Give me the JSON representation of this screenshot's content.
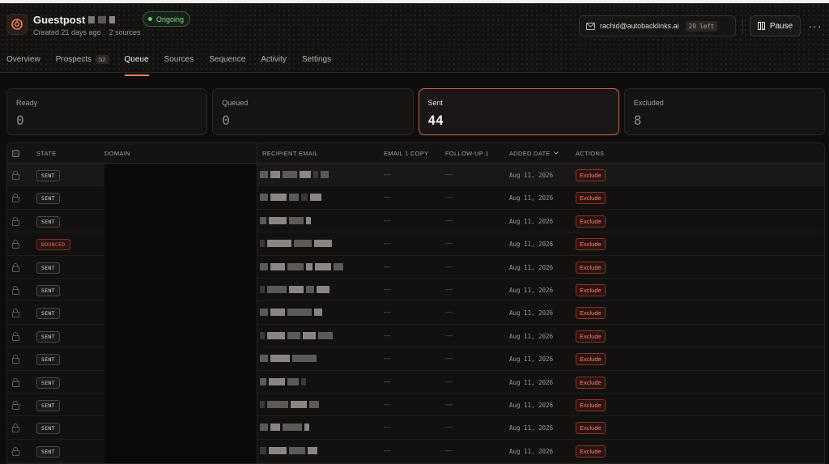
{
  "header": {
    "title": "Guestpost",
    "created": "Created 21 days ago",
    "sources": "2 sources",
    "status": "Ongoing",
    "sender_email": "rachid@autobacklinks.ai",
    "left_count": "29 left",
    "pause_label": "Pause",
    "more_icon": "more-horizontal-icon"
  },
  "tabs": [
    {
      "label": "Overview",
      "count": ""
    },
    {
      "label": "Prospects",
      "count": "52"
    },
    {
      "label": "Queue",
      "count": "",
      "active": true
    },
    {
      "label": "Sources",
      "count": ""
    },
    {
      "label": "Sequence",
      "count": ""
    },
    {
      "label": "Activity",
      "count": ""
    },
    {
      "label": "Settings",
      "count": ""
    }
  ],
  "stats": [
    {
      "label": "Ready",
      "value": "0"
    },
    {
      "label": "Queued",
      "value": "0"
    },
    {
      "label": "Sent",
      "value": "44",
      "active": true
    },
    {
      "label": "Excluded",
      "value": "8"
    }
  ],
  "table": {
    "columns": {
      "state": "STATE",
      "domain": "DOMAIN",
      "recipient": "RECIPIENT EMAIL",
      "email1": "EMAIL 1 COPY",
      "followup": "FOLLOW-UP 1",
      "added": "ADDED DATE",
      "actions": "ACTIONS"
    },
    "sort_icon": "chevron-down-icon",
    "rows": [
      {
        "state": "SENT",
        "favicon": "#e7868c",
        "email1": "—",
        "followup": "—",
        "date": "Aug 11, 2026",
        "action": "Exclude"
      },
      {
        "state": "SENT",
        "favicon": "#7d1a22",
        "email1": "—",
        "followup": "—",
        "date": "Aug 11, 2026",
        "action": "Exclude"
      },
      {
        "state": "SENT",
        "favicon": "#1f6a4a",
        "email1": "—",
        "followup": "—",
        "date": "Aug 11, 2026",
        "action": "Exclude"
      },
      {
        "state": "BOUNCED",
        "favicon": "#8fc6e6",
        "email1": "—",
        "followup": "—",
        "date": "Aug 11, 2026",
        "action": "Exclude"
      },
      {
        "state": "SENT",
        "favicon": "#2d64a6",
        "email1": "—",
        "followup": "—",
        "date": "Aug 11, 2026",
        "action": "Exclude"
      },
      {
        "state": "SENT",
        "favicon": "#e85f2c",
        "email1": "—",
        "followup": "—",
        "date": "Aug 11, 2026",
        "action": "Exclude"
      },
      {
        "state": "SENT",
        "favicon": "#c2491e",
        "email1": "—",
        "followup": "—",
        "date": "Aug 11, 2026",
        "action": "Exclude"
      },
      {
        "state": "SENT",
        "favicon": "#f3f3f3",
        "email1": "—",
        "followup": "—",
        "date": "Aug 11, 2026",
        "action": "Exclude"
      },
      {
        "state": "SENT",
        "favicon": "#b8401e",
        "email1": "—",
        "followup": "—",
        "date": "Aug 11, 2026",
        "action": "Exclude"
      },
      {
        "state": "SENT",
        "favicon": "#0f1a1c",
        "email1": "—",
        "followup": "—",
        "date": "Aug 11, 2026",
        "action": "Exclude"
      },
      {
        "state": "SENT",
        "favicon": "#1b1a22",
        "email1": "—",
        "followup": "—",
        "date": "Aug 11, 2026",
        "action": "Exclude"
      },
      {
        "state": "SENT",
        "favicon": "#e85a7e",
        "email1": "—",
        "followup": "—",
        "date": "Aug 11, 2026",
        "action": "Exclude"
      },
      {
        "state": "SENT",
        "favicon": "#101010",
        "email1": "—",
        "followup": "—",
        "date": "Aug 11, 2026",
        "action": "Exclude"
      }
    ]
  },
  "colors": {
    "accent": "#e9825c",
    "exclude": "#ff7a6a",
    "ongoing": "#5ad15a"
  }
}
